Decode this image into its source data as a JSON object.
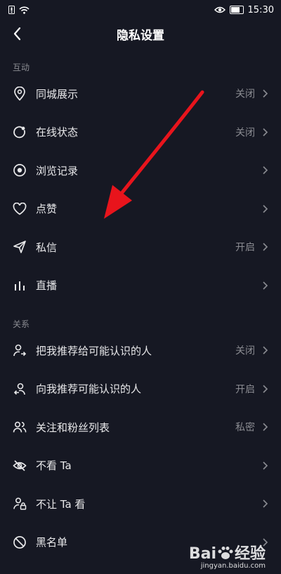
{
  "status": {
    "time": "15:30"
  },
  "header": {
    "title": "隐私设置"
  },
  "sections": [
    {
      "label": "互动",
      "items": [
        {
          "label": "同城展示",
          "value": "关闭",
          "icon": "location-pin-icon"
        },
        {
          "label": "在线状态",
          "value": "关闭",
          "icon": "online-status-icon"
        },
        {
          "label": "浏览记录",
          "value": "",
          "icon": "eye-icon"
        },
        {
          "label": "点赞",
          "value": "",
          "icon": "heart-icon"
        },
        {
          "label": "私信",
          "value": "开启",
          "icon": "paper-plane-icon"
        },
        {
          "label": "直播",
          "value": "",
          "icon": "bars-icon"
        }
      ]
    },
    {
      "label": "关系",
      "items": [
        {
          "label": "把我推荐给可能认识的人",
          "value": "关闭",
          "icon": "user-share-icon"
        },
        {
          "label": "向我推荐可能认识的人",
          "value": "开启",
          "icon": "user-recommend-icon"
        },
        {
          "label": "关注和粉丝列表",
          "value": "私密",
          "icon": "users-icon"
        },
        {
          "label": "不看 Ta",
          "value": "",
          "icon": "eye-off-icon"
        },
        {
          "label": "不让 Ta 看",
          "value": "",
          "icon": "user-lock-icon"
        },
        {
          "label": "黑名单",
          "value": "",
          "icon": "block-icon"
        }
      ]
    }
  ],
  "watermark": {
    "brand": "Bai",
    "brand2": "经验",
    "url": "jingyan.baidu.com"
  },
  "colors": {
    "background": "#161823",
    "text": "#e8e8ea",
    "muted": "#8a8b91",
    "annotation_arrow": "#e8141c"
  }
}
